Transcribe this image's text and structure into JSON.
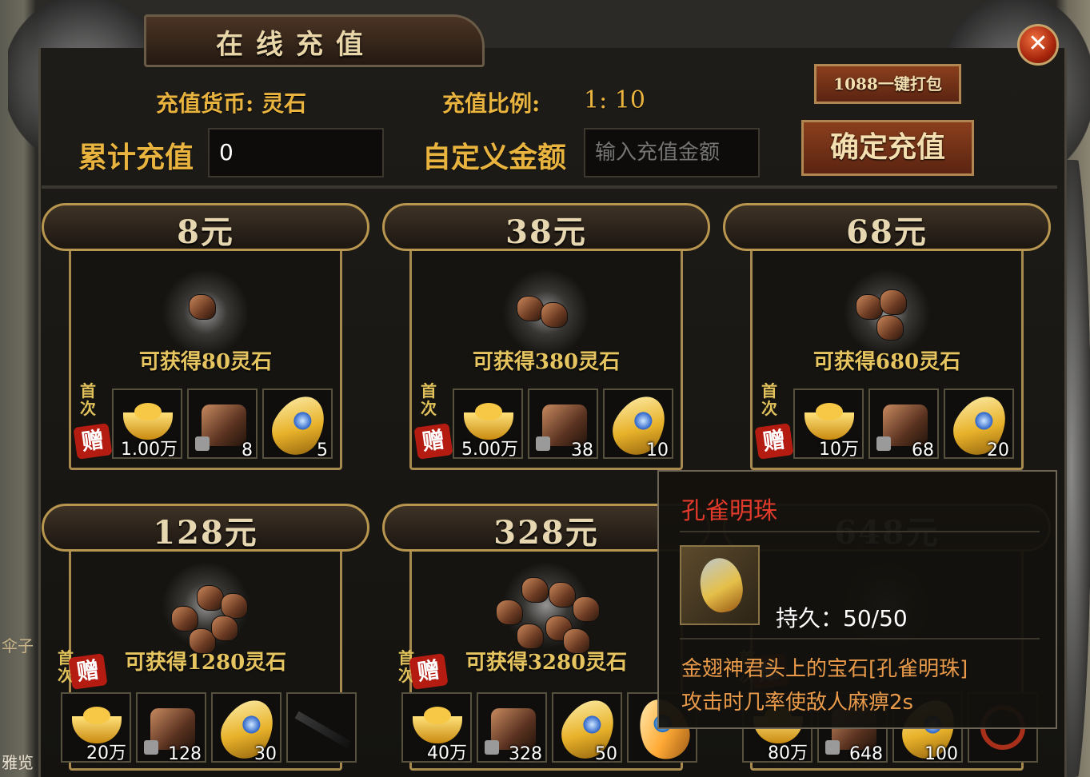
{
  "window": {
    "title": "在线充值",
    "close_label": "✕"
  },
  "header": {
    "currency_label": "充值货币: 灵石",
    "ratio_label": "充值比例:",
    "ratio_value": "1: 10",
    "total_label": "累计充值",
    "total_value": "0",
    "custom_label": "自定义金额",
    "custom_placeholder": "输入充值金额",
    "pack_button": "1088一键打包",
    "confirm_button": "确定充值"
  },
  "badges": {
    "first_time": "首次",
    "gift": "赠"
  },
  "cards": [
    {
      "price": "8元",
      "gain": "可获得80灵石",
      "items": [
        {
          "icon": "gold-ingot",
          "count": "1.00万"
        },
        {
          "icon": "locked-stone-chest",
          "count": "8"
        },
        {
          "icon": "golden-feather",
          "count": "5"
        }
      ]
    },
    {
      "price": "38元",
      "gain": "可获得380灵石",
      "items": [
        {
          "icon": "gold-ingot",
          "count": "5.00万"
        },
        {
          "icon": "locked-stone-chest",
          "count": "38"
        },
        {
          "icon": "golden-feather",
          "count": "10"
        }
      ]
    },
    {
      "price": "68元",
      "gain": "可获得680灵石",
      "items": [
        {
          "icon": "gold-ingot",
          "count": "10万"
        },
        {
          "icon": "locked-stone-chest",
          "count": "68"
        },
        {
          "icon": "golden-feather",
          "count": "20"
        }
      ]
    },
    {
      "price": "128元",
      "gain": "可获得1280灵石",
      "items": [
        {
          "icon": "gold-ingot",
          "count": "20万"
        },
        {
          "icon": "locked-stone-chest",
          "count": "128"
        },
        {
          "icon": "golden-feather",
          "count": "30"
        },
        {
          "icon": "dark-sword",
          "count": ""
        }
      ]
    },
    {
      "price": "328元",
      "gain": "可获得3280灵石",
      "items": [
        {
          "icon": "gold-ingot",
          "count": "40万"
        },
        {
          "icon": "locked-stone-chest",
          "count": "328"
        },
        {
          "icon": "golden-feather",
          "count": "50"
        },
        {
          "icon": "peacock-pearl",
          "count": ""
        }
      ]
    },
    {
      "price": "648元",
      "gain": "",
      "items": [
        {
          "icon": "gold-ingot",
          "count": "80万"
        },
        {
          "icon": "locked-stone-chest",
          "count": "648"
        },
        {
          "icon": "golden-feather",
          "count": "100"
        },
        {
          "icon": "red-ring",
          "count": ""
        }
      ]
    }
  ],
  "tooltip": {
    "name": "孔雀明珠",
    "durability": "持久：50/50",
    "desc_line1": "金翅神君头上的宝石[孔雀明珠]",
    "desc_line2": "攻击时几率使敌人麻痹2s"
  },
  "side_texts": {
    "left_mid": "伞子",
    "left_bottom": "雅览"
  },
  "colors": {
    "gold_text": "#e8b33e",
    "tooltip_title": "#e23a2a",
    "tooltip_desc": "#e89a4a"
  }
}
